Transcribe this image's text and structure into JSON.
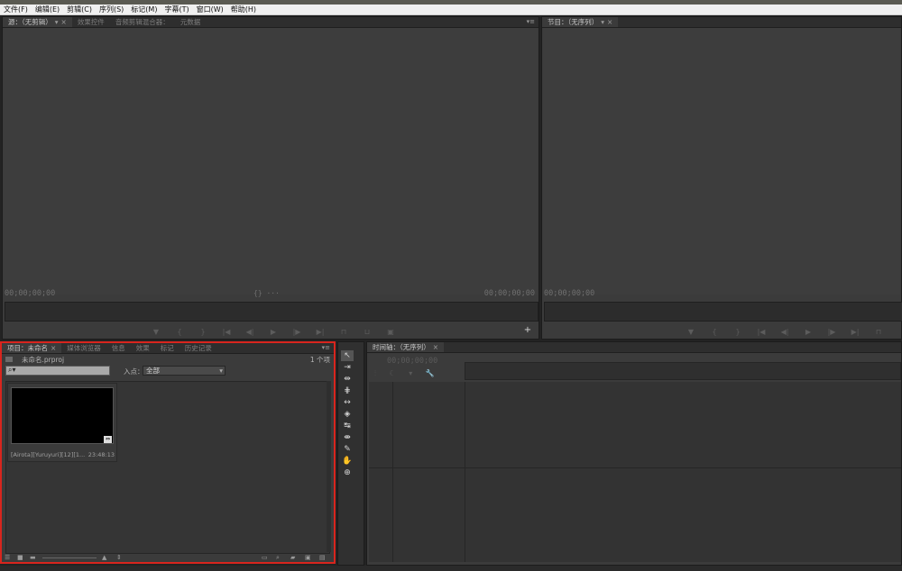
{
  "menu": [
    "文件(F)",
    "编辑(E)",
    "剪辑(C)",
    "序列(S)",
    "标记(M)",
    "字幕(T)",
    "窗口(W)",
    "帮助(H)"
  ],
  "source_monitor": {
    "tabs": [
      {
        "label": "源：（无剪辑）",
        "active": true
      },
      {
        "label": "效果控件",
        "active": false
      },
      {
        "label": "音频剪辑混合器：",
        "active": false
      },
      {
        "label": "元数据",
        "active": false
      }
    ],
    "timecode_left": "00;00;00;00",
    "timecode_right": "00;00;00;00",
    "mid_glyph": "{}  ···"
  },
  "program_monitor": {
    "tab": "节目：（无序列）",
    "timecode_left": "00;00;00;00"
  },
  "project_panel": {
    "tabs": [
      {
        "label": "项目：未命名",
        "active": true
      },
      {
        "label": "媒体浏览器",
        "active": false
      },
      {
        "label": "信息",
        "active": false
      },
      {
        "label": "效果",
        "active": false
      },
      {
        "label": "标记",
        "active": false
      },
      {
        "label": "历史记录",
        "active": false
      }
    ],
    "project_file": "未命名.prproj",
    "item_count": "1 个项",
    "search_placeholder": "",
    "in_point_label": "入点：",
    "in_point_value": "全部",
    "clip": {
      "name": "[Airota][Yuruyuri][12][1...",
      "duration": "23:48:13"
    }
  },
  "timeline": {
    "tab": "时间轴：（无序列）",
    "timecode": "00;00;00;00"
  },
  "colors": {
    "highlight_border": "#d8251e",
    "panel_bg": "#3b3b3b",
    "app_bg": "#232323"
  },
  "icons": {
    "transport": [
      "add-marker-icon",
      "mark-in-icon",
      "mark-out-icon",
      "go-to-in-icon",
      "step-back-icon",
      "play-icon",
      "step-forward-icon",
      "go-to-out-icon",
      "insert-icon",
      "overwrite-icon",
      "export-frame-icon"
    ],
    "tools": [
      "selection-tool-icon",
      "track-select-tool-icon",
      "ripple-edit-tool-icon",
      "rolling-edit-tool-icon",
      "rate-stretch-tool-icon",
      "razor-tool-icon",
      "slip-tool-icon",
      "slide-tool-icon",
      "pen-tool-icon",
      "hand-tool-icon",
      "zoom-tool-icon"
    ]
  }
}
